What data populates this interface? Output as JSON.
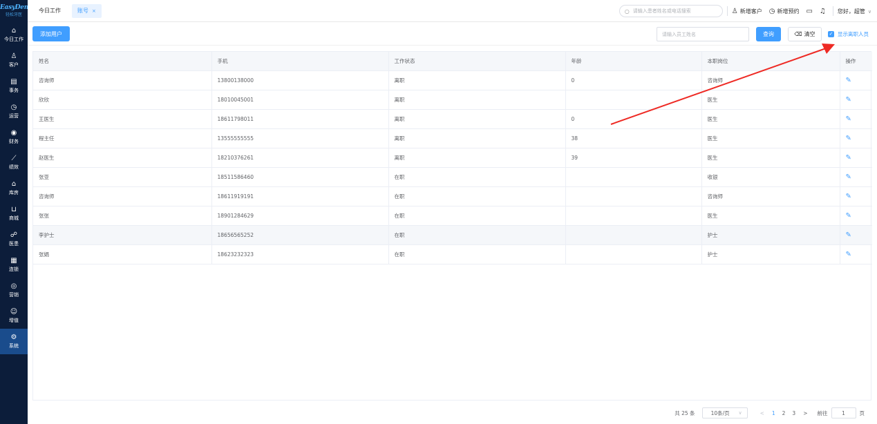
{
  "sidebar": {
    "logo": "EasyDent",
    "logo_sub": "轻松牙医",
    "items": [
      {
        "label": "今日工作",
        "icon": "home-icon",
        "glyph": "⌂"
      },
      {
        "label": "客户",
        "icon": "user-icon",
        "glyph": "♙"
      },
      {
        "label": "事务",
        "icon": "clipboard-icon",
        "glyph": "▤"
      },
      {
        "label": "运营",
        "icon": "clock-icon",
        "glyph": "◷"
      },
      {
        "label": "财务",
        "icon": "money-icon",
        "glyph": "◉"
      },
      {
        "label": "绩效",
        "icon": "chart-icon",
        "glyph": "⟋"
      },
      {
        "label": "库房",
        "icon": "warehouse-icon",
        "glyph": "⌂"
      },
      {
        "label": "商城",
        "icon": "cart-icon",
        "glyph": "⊔"
      },
      {
        "label": "医患",
        "icon": "doctor-patient-icon",
        "glyph": "☍"
      },
      {
        "label": "连锁",
        "icon": "chain-icon",
        "glyph": "▦"
      },
      {
        "label": "营销",
        "icon": "marketing-icon",
        "glyph": "◎"
      },
      {
        "label": "增值",
        "icon": "value-added-icon",
        "glyph": "☺"
      },
      {
        "label": "系统",
        "icon": "settings-icon",
        "glyph": "⚙"
      }
    ],
    "active_index": 12
  },
  "header": {
    "tab_today": "今日工作",
    "tab_active": "账号",
    "tab_close": "×",
    "search_placeholder": "请输入患者姓名或电话搜索",
    "new_customer": "新增客户",
    "new_appointment": "新增预约",
    "greeting": "您好，超管"
  },
  "toolbar": {
    "add_user": "添加用户",
    "name_placeholder": "请输入员工姓名",
    "query": "查询",
    "clear": "清空",
    "show_resigned": "显示离职人员",
    "show_resigned_checked": true
  },
  "table": {
    "columns": [
      "姓名",
      "手机",
      "工作状态",
      "年龄",
      "本职岗位",
      "操作"
    ],
    "rows": [
      {
        "name": "咨询师",
        "phone": "13800138000",
        "status": "离职",
        "age": "0",
        "position": "咨询师"
      },
      {
        "name": "欣欣",
        "phone": "18010045001",
        "status": "离职",
        "age": "",
        "position": "医生"
      },
      {
        "name": "王医生",
        "phone": "18611798011",
        "status": "离职",
        "age": "0",
        "position": "医生"
      },
      {
        "name": "程主任",
        "phone": "13555555555",
        "status": "离职",
        "age": "38",
        "position": "医生"
      },
      {
        "name": "赵医生",
        "phone": "18210376261",
        "status": "离职",
        "age": "39",
        "position": "医生"
      },
      {
        "name": "张亚",
        "phone": "18511586460",
        "status": "在职",
        "age": "",
        "position": "收银"
      },
      {
        "name": "咨询师",
        "phone": "18611919191",
        "status": "在职",
        "age": "",
        "position": "咨询师"
      },
      {
        "name": "张张",
        "phone": "18901284629",
        "status": "在职",
        "age": "",
        "position": "医生"
      },
      {
        "name": "李护士",
        "phone": "18656565252",
        "status": "在职",
        "age": "",
        "position": "护士"
      },
      {
        "name": "张娟",
        "phone": "18623232323",
        "status": "在职",
        "age": "",
        "position": "护士"
      }
    ],
    "highlighted_row": 8
  },
  "pagination": {
    "total": "共 25 条",
    "page_size": "10条/页",
    "pages": [
      "1",
      "2",
      "3"
    ],
    "current": "1",
    "goto_label": "前往",
    "goto_value": "1",
    "page_unit": "页"
  },
  "colors": {
    "primary": "#409eff",
    "sidebar_bg": "#0c1d3a",
    "annotation_arrow": "#ee2a24"
  }
}
